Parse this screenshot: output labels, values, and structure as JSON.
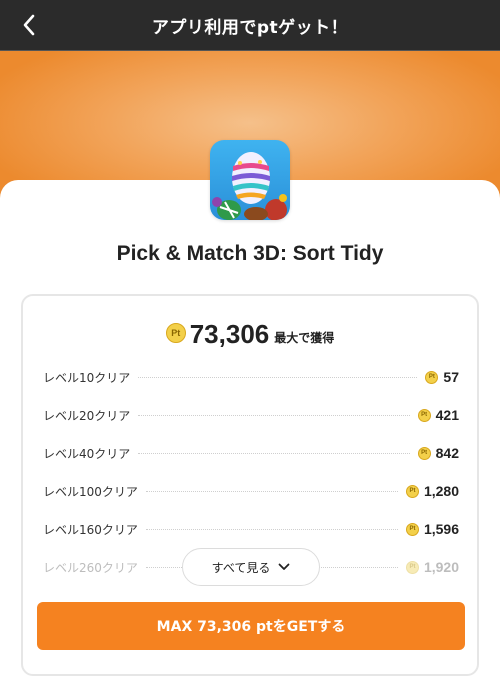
{
  "header": {
    "title": "アプリ利用でptゲット！",
    "back_icon": "chevron-left-icon"
  },
  "app": {
    "name": "Pick & Match 3D: Sort Tidy",
    "icon": "easter-egg-app-icon"
  },
  "reward": {
    "total": "73,306",
    "total_suffix": "最大で獲得",
    "coin_label": "Pt",
    "tasks": [
      {
        "label": "レベル10クリア",
        "points": "57"
      },
      {
        "label": "レベル20クリア",
        "points": "421"
      },
      {
        "label": "レベル40クリア",
        "points": "842"
      },
      {
        "label": "レベル100クリア",
        "points": "1,280"
      },
      {
        "label": "レベル160クリア",
        "points": "1,596"
      },
      {
        "label": "レベル260クリア",
        "points": "1,920"
      }
    ],
    "see_all_label": "すべて見る",
    "cta_label": "MAX 73,306 ptをGETする"
  },
  "colors": {
    "accent": "#f58220",
    "header_bg": "#2b2b2b",
    "coin": "#f3d04a"
  }
}
